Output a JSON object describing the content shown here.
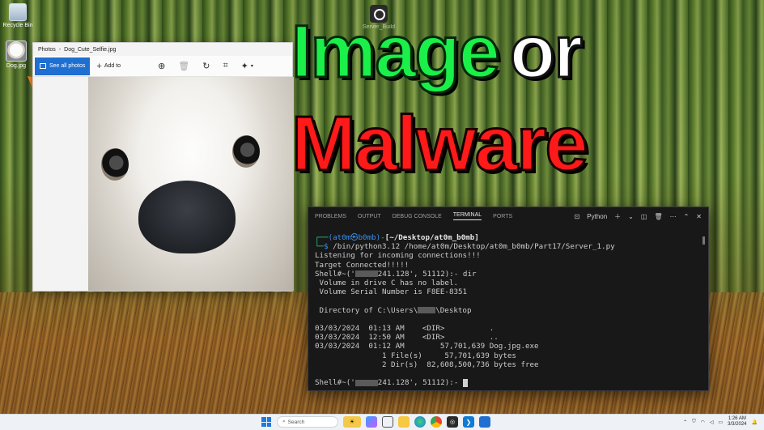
{
  "desktop": {
    "icons": [
      {
        "label": "Recycle Bin"
      },
      {
        "label": "Dog.jpg"
      },
      {
        "label": "Server_Build"
      }
    ]
  },
  "headline": {
    "line1_word1": "Image",
    "line1_word2": "or",
    "line2": "Malware",
    "colors": {
      "image": "#1bef4a",
      "or": "#ffffff",
      "malware": "#ff1a1a"
    }
  },
  "photos": {
    "title_app": "Photos",
    "title_sep": "-",
    "title_file": "Dog_Cute_Selfie.jpg",
    "see_all_label": "See all photos",
    "add_to_label": "Add to",
    "tool_icons": [
      "zoom-in-icon",
      "delete-icon",
      "rotate-icon",
      "crop-icon",
      "edit-icon"
    ]
  },
  "terminal": {
    "tabs": [
      "PROBLEMS",
      "OUTPUT",
      "DEBUG CONSOLE",
      "TERMINAL",
      "PORTS"
    ],
    "active_tab": "TERMINAL",
    "profile_label": "Python",
    "prompt_user": "(at0m㉿b0mb)",
    "prompt_dir": "[~/Desktop/at0m_b0mb]",
    "command": "/bin/python3.12 /home/at0m/Desktop/at0m_b0mb/Part17/Server_1.py",
    "lines": [
      "Listening for incoming connections!!!",
      "Target Connected!!!!!"
    ],
    "shell_prefix": "Shell#~('",
    "shell_ip_tail": "241.128', 51112):- ",
    "shell_cmd1": "dir",
    "dir_out1": " Volume in drive C has no label.",
    "dir_out2": " Volume Serial Number is F8EE-8351",
    "dir_header_prefix": " Directory of C:\\Users\\",
    "dir_header_suffix": "\\Desktop",
    "entries": [
      "03/03/2024  01:13 AM    <DIR>          .",
      "03/03/2024  12:50 AM    <DIR>          ..",
      "03/03/2024  01:12 AM        57,701,639 Dog.jpg.exe"
    ],
    "summary1": "               1 File(s)     57,701,639 bytes",
    "summary2": "               2 Dir(s)  82,608,500,736 bytes free",
    "colors": {
      "prompt": "#23d18b",
      "path": "#3b8eea",
      "background": "#181818"
    }
  },
  "taskbar": {
    "search_placeholder": "Search",
    "time": "1:26 AM",
    "date": "3/3/2024",
    "apps": [
      "widgets-icon",
      "copilot-icon",
      "task-view-icon",
      "file-explorer-icon",
      "edge-icon",
      "chrome-icon",
      "security-icon",
      "vscode-icon",
      "photos-icon"
    ]
  }
}
